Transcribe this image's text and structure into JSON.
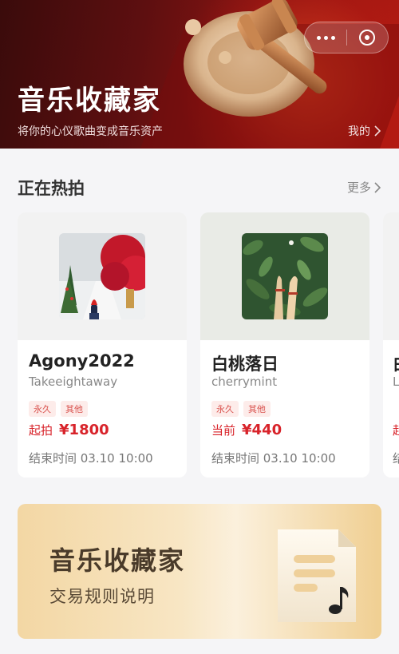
{
  "header": {
    "title": "音乐收藏家",
    "subtitle": "将你的心仪歌曲变成音乐资产",
    "mine_label": "我的"
  },
  "section": {
    "title": "正在热拍",
    "more_label": "更多"
  },
  "cards": [
    {
      "name": "Agony2022",
      "artist": "Takeeightaway",
      "tags": [
        "永久",
        "其他"
      ],
      "price_label": "起拍",
      "price": "¥1800",
      "end_time": "结束时间 03.10 10:00",
      "cover": "snowy-forest-cover"
    },
    {
      "name": "白桃落日",
      "artist": "cherrymint",
      "tags": [
        "永久",
        "其他"
      ],
      "price_label": "当前",
      "price": "¥440",
      "end_time": "结束时间 03.10 10:00",
      "cover": "leaves-hands-cover"
    },
    {
      "name": "白",
      "artist": "L",
      "price_label": "起",
      "end_time": "结"
    }
  ],
  "promo": {
    "title": "音乐收藏家",
    "subtitle": "交易规则说明"
  },
  "colors": {
    "accent_red": "#d8232a",
    "header_dark": "#3a0b0b",
    "header_red": "#b21a12",
    "promo_gold": "#f3d7a4"
  },
  "icons": {
    "mine_chevron": "chevron-right-icon",
    "more_chevron": "chevron-right-icon",
    "capsule_more": "more-dots-icon",
    "capsule_close": "close-circle-icon",
    "header_art": "gavel-icon",
    "promo_art": "document-music-icon"
  }
}
